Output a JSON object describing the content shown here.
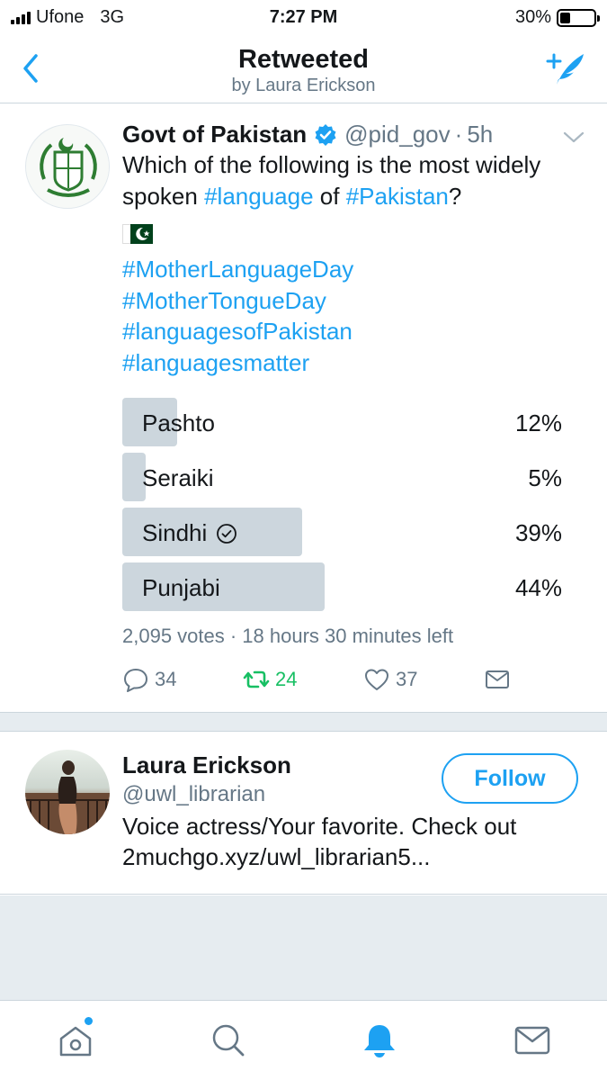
{
  "status_bar": {
    "carrier": "Ufone",
    "network": "3G",
    "time": "7:27 PM",
    "battery_text": "30%",
    "battery_level": 0.3
  },
  "header": {
    "title": "Retweeted",
    "subtitle": "by Laura Erickson",
    "back_icon": "chevron-left-icon",
    "compose_icon": "compose-tweet-icon"
  },
  "tweet": {
    "author_name": "Govt of Pakistan",
    "handle": "@pid_gov",
    "separator": "·",
    "time": "5h",
    "text_before": "Which of the following is the most widely spoken ",
    "hashtag_1": "#language",
    "text_middle": " of ",
    "hashtag_2": "#Pakistan",
    "text_after": "?",
    "hashtags": [
      "#MotherLanguageDay",
      "#MotherTongueDay",
      "#languagesofPakistan",
      "#languagesmatter"
    ],
    "poll": {
      "options": [
        {
          "label": "Pashto",
          "percent_text": "12%",
          "percent": 12,
          "selected": false
        },
        {
          "label": "Seraiki",
          "percent_text": "5%",
          "percent": 5,
          "selected": false
        },
        {
          "label": "Sindhi",
          "percent_text": "39%",
          "percent": 39,
          "selected": true
        },
        {
          "label": "Punjabi",
          "percent_text": "44%",
          "percent": 44,
          "selected": false
        }
      ],
      "meta": "2,095 votes · 18 hours 30 minutes left"
    },
    "actions": {
      "replies": "34",
      "retweets": "24",
      "likes": "37"
    }
  },
  "user_card": {
    "name": "Laura Erickson",
    "handle": "@uwl_librarian",
    "bio_line1": "Voice actress/Your favorite. Check out",
    "bio_line2": "2muchgo.xyz/uwl_librarian5...",
    "follow_label": "Follow"
  },
  "tab_bar": {
    "tabs": [
      "home-icon",
      "search-icon",
      "notifications-icon",
      "messages-icon"
    ],
    "active": "notifications-icon"
  },
  "colors": {
    "accent": "#1da1f2",
    "retweet_green": "#17bf63",
    "muted": "#657786",
    "poll_bar": "#ccd6dd"
  }
}
